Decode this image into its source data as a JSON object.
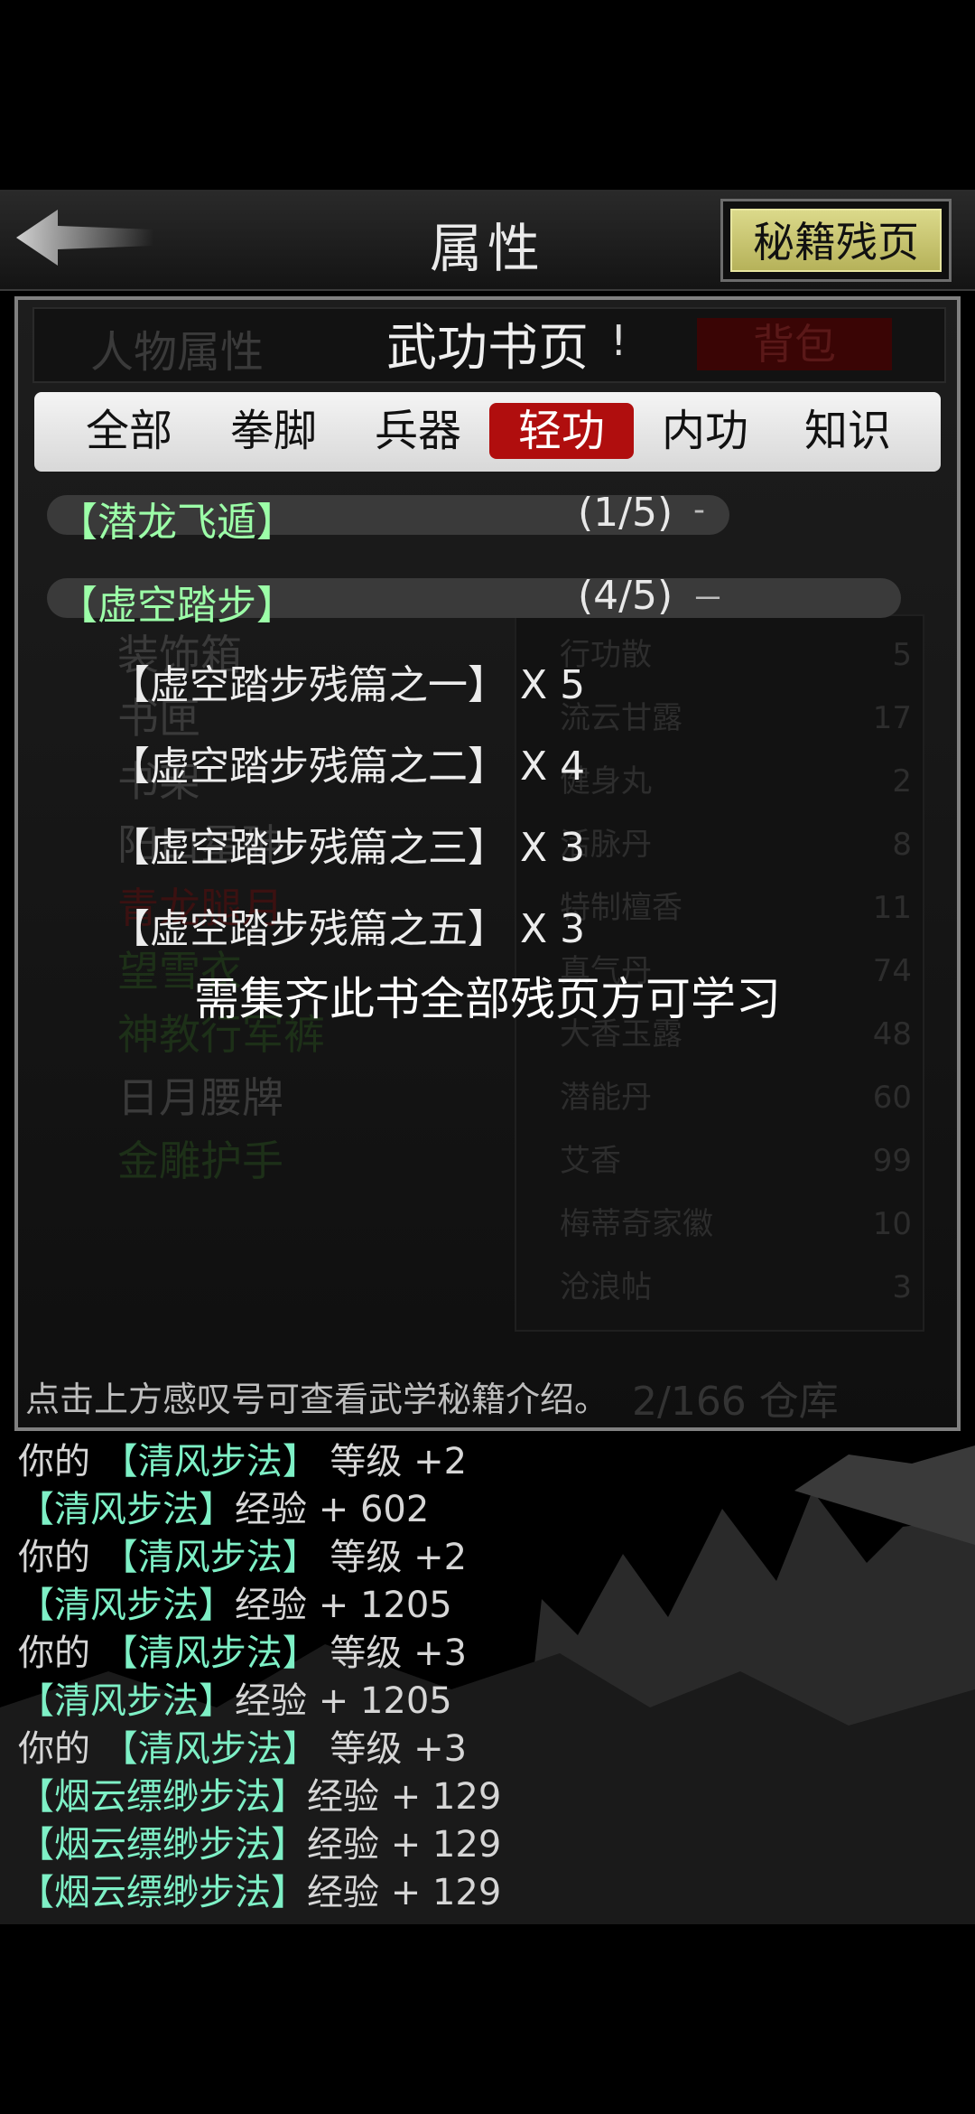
{
  "header": {
    "title": "属性",
    "shard_button": "秘籍残页"
  },
  "background_page": {
    "tab_left": "人物属性",
    "tab_right": "背包",
    "list": [
      "装饰箱",
      "书匣",
      "书架",
      "阳口星砷",
      "青龙腿月",
      "望雪衣",
      "神教行军裤",
      "日月腰牌",
      "金雕护手"
    ],
    "items": [
      {
        "name": "行功散",
        "count": "5"
      },
      {
        "name": "流云甘露",
        "count": "17"
      },
      {
        "name": "健身丸",
        "count": "2"
      },
      {
        "name": "活脉丹",
        "count": "8"
      },
      {
        "name": "特制檀香",
        "count": "11"
      },
      {
        "name": "真气丹",
        "count": "74"
      },
      {
        "name": "大香玉露",
        "count": "48"
      },
      {
        "name": "潜能丹",
        "count": "60"
      },
      {
        "name": "艾香",
        "count": "99"
      },
      {
        "name": "梅蒂奇家徽",
        "count": "10"
      },
      {
        "name": "沧浪帖",
        "count": "3"
      }
    ],
    "footer": "2/166 仓库"
  },
  "dialog": {
    "title": "武功书页",
    "info_icon": "!",
    "tabs": [
      "全部",
      "拳脚",
      "兵器",
      "轻功",
      "内功",
      "知识"
    ],
    "active_tab": "轻功",
    "groups": [
      {
        "name": "【潜龙飞遁】",
        "count": "(1/5)",
        "toggle": "-"
      },
      {
        "name": "【虚空踏步】",
        "count": "(4/5)",
        "toggle": "－"
      }
    ],
    "shards": [
      "【虚空踏步残篇之一】 X 5",
      "【虚空踏步残篇之二】 X 4",
      "【虚空踏步残篇之三】 X 3",
      "【虚空踏步残篇之五】 X 3"
    ],
    "requirement_note": "需集齐此书全部残页方可学习",
    "hint": "点击上方感叹号可查看武学秘籍介绍。"
  },
  "log": [
    {
      "prefix": "你的 ",
      "skill": "【清风步法】",
      "text": " 等级 +2"
    },
    {
      "prefix": "",
      "skill": "【清风步法】",
      "text": "经验 + 602"
    },
    {
      "prefix": "你的 ",
      "skill": "【清风步法】",
      "text": " 等级 +2"
    },
    {
      "prefix": "",
      "skill": "【清风步法】",
      "text": "经验 + 1205"
    },
    {
      "prefix": "你的 ",
      "skill": "【清风步法】",
      "text": " 等级 +3"
    },
    {
      "prefix": "",
      "skill": "【清风步法】",
      "text": "经验 + 1205"
    },
    {
      "prefix": "你的 ",
      "skill": "【清风步法】",
      "text": " 等级 +3"
    },
    {
      "prefix": "",
      "skill": "【烟云缥缈步法】",
      "text": "经验 + 129"
    },
    {
      "prefix": "",
      "skill": "【烟云缥缈步法】",
      "text": "经验 + 129"
    },
    {
      "prefix": "",
      "skill": "【烟云缥缈步法】",
      "text": "经验 + 129"
    }
  ],
  "colors": {
    "accent_red": "#b00e0e",
    "skill_green": "#7ef0c6",
    "group_green": "#9cffa8",
    "button_yellow": "#d2cf78"
  }
}
